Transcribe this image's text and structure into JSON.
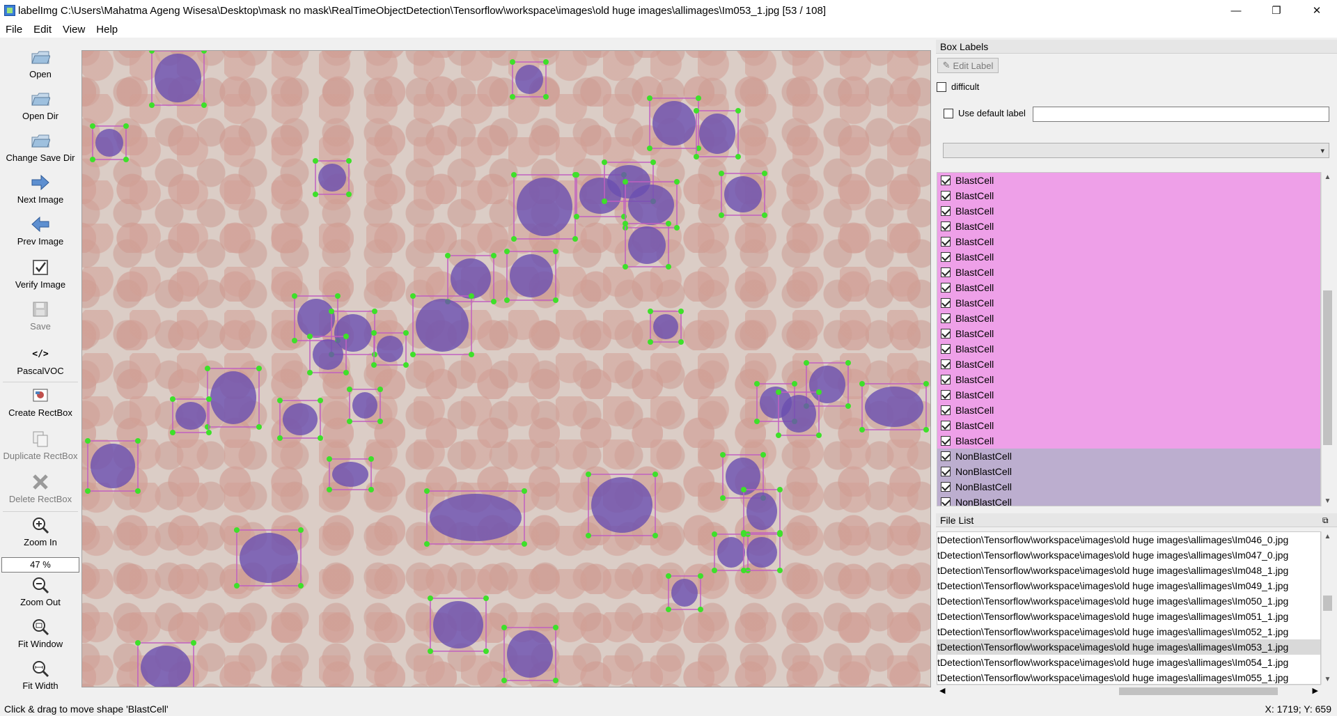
{
  "window": {
    "title": "labelImg C:\\Users\\Mahatma Ageng Wisesa\\Desktop\\mask no mask\\RealTimeObjectDetection\\Tensorflow\\workspace\\images\\old huge images\\allimages\\Im053_1.jpg [53 / 108]",
    "minimize": "—",
    "maximize": "❐",
    "close": "✕"
  },
  "menu": {
    "file": "File",
    "edit": "Edit",
    "view": "View",
    "help": "Help"
  },
  "toolbar": {
    "open": "Open",
    "open_dir": "Open Dir",
    "change_save_dir": "Change Save Dir",
    "next_image": "Next Image",
    "prev_image": "Prev Image",
    "verify_image": "Verify Image",
    "save": "Save",
    "format_icon": "</>",
    "format": "PascalVOC",
    "create_rectbox": "Create RectBox",
    "duplicate_rectbox": "Duplicate RectBox",
    "delete_rectbox": "Delete RectBox",
    "zoom_in": "Zoom In",
    "zoom_value": "47 %",
    "zoom_out": "Zoom Out",
    "fit_window": "Fit Window",
    "fit_width": "Fit Width"
  },
  "box_labels": {
    "title": "Box Labels",
    "edit_label": "Edit Label",
    "difficult": "difficult",
    "use_default_label": "Use default label",
    "default_label_value": "",
    "combo_value": "",
    "items": [
      "BlastCell",
      "BlastCell",
      "BlastCell",
      "BlastCell",
      "BlastCell",
      "BlastCell",
      "BlastCell",
      "BlastCell",
      "BlastCell",
      "BlastCell",
      "BlastCell",
      "BlastCell",
      "BlastCell",
      "BlastCell",
      "BlastCell",
      "BlastCell",
      "BlastCell",
      "BlastCell",
      "NonBlastCell",
      "NonBlastCell",
      "NonBlastCell",
      "NonBlastCell"
    ]
  },
  "file_list": {
    "title": "File List",
    "files": [
      "tDetection\\Tensorflow\\workspace\\images\\old huge images\\allimages\\Im046_0.jpg",
      "tDetection\\Tensorflow\\workspace\\images\\old huge images\\allimages\\Im047_0.jpg",
      "tDetection\\Tensorflow\\workspace\\images\\old huge images\\allimages\\Im048_1.jpg",
      "tDetection\\Tensorflow\\workspace\\images\\old huge images\\allimages\\Im049_1.jpg",
      "tDetection\\Tensorflow\\workspace\\images\\old huge images\\allimages\\Im050_1.jpg",
      "tDetection\\Tensorflow\\workspace\\images\\old huge images\\allimages\\Im051_1.jpg",
      "tDetection\\Tensorflow\\workspace\\images\\old huge images\\allimages\\Im052_1.jpg",
      "tDetection\\Tensorflow\\workspace\\images\\old huge images\\allimages\\Im053_1.jpg",
      "tDetection\\Tensorflow\\workspace\\images\\old huge images\\allimages\\Im054_1.jpg",
      "tDetection\\Tensorflow\\workspace\\images\\old huge images\\allimages\\Im055_1.jpg"
    ],
    "selected_file": "Im053_1.jpg"
  },
  "status": {
    "message": "Click & drag to move shape 'BlastCell'",
    "coords": "X: 1719; Y: 659"
  },
  "colors": {
    "blast_row": "#eea0e8",
    "nonblast_row": "#bcaecf",
    "box_outline": "#c060c0",
    "vertex": "#3ee02a"
  }
}
